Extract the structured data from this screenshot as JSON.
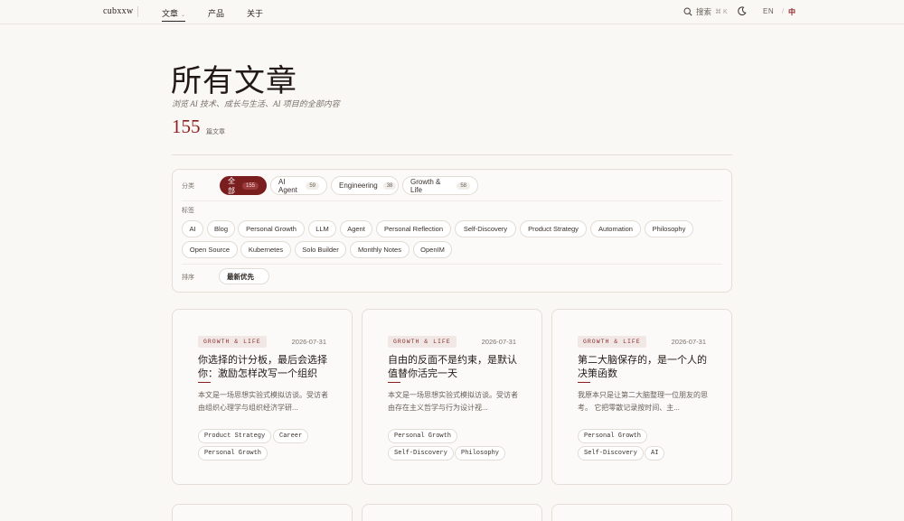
{
  "nav": {
    "brand": "cubxxw",
    "items": [
      {
        "label": "文章"
      },
      {
        "label": "产品"
      },
      {
        "label": "关于"
      }
    ],
    "search_label": "搜索",
    "search_shortcut": "⌘ K",
    "lang_en": "EN",
    "lang_sep": "/",
    "lang_zh": "中"
  },
  "hero": {
    "title": "所有文章",
    "subtitle": "浏览 AI 技术、成长与生活、AI 项目的全部内容",
    "count": "155",
    "count_label": "篇文章"
  },
  "filters": {
    "category_label": "分类",
    "categories": [
      {
        "label": "全部",
        "count": "155"
      },
      {
        "label": "AI Agent",
        "count": "59"
      },
      {
        "label": "Engineering",
        "count": "38"
      },
      {
        "label": "Growth & Life",
        "count": "58"
      }
    ],
    "tag_label": "标签",
    "tags": [
      "AI",
      "Blog",
      "Personal Growth",
      "LLM",
      "Agent",
      "Personal Reflection",
      "Self-Discovery",
      "Product Strategy",
      "Automation",
      "Philosophy",
      "Open Source",
      "Kubernetes",
      "Solo Builder",
      "Monthly Notes",
      "OpenIM"
    ],
    "sort_label": "排序",
    "sort_value": "最新优先"
  },
  "cards": [
    {
      "category": "GROWTH & LIFE",
      "date": "2026-07-31",
      "title": "你选择的计分板，最后会选择你：激励怎样改写一个组织",
      "excerpt": "本文是一场思想实验式模拟访谈。受访者由组织心理学与组织经济学研...",
      "tags": [
        "Product Strategy",
        "Career",
        "Personal Growth"
      ]
    },
    {
      "category": "GROWTH & LIFE",
      "date": "2026-07-31",
      "title": "自由的反面不是约束，是默认值替你活完一天",
      "excerpt": "本文是一场思想实验式模拟访谈。受访者由存在主义哲学与行为设计视...",
      "tags": [
        "Personal Growth",
        "Self-Discovery",
        "Philosophy"
      ]
    },
    {
      "category": "GROWTH & LIFE",
      "date": "2026-07-31",
      "title": "第二大脑保存的，是一个人的决策函数",
      "excerpt": "我原本只是让第二大脑整理一位朋友的思考。 它把零散记录按时间、主...",
      "tags": [
        "Personal Growth",
        "Self-Discovery",
        "AI"
      ]
    }
  ]
}
